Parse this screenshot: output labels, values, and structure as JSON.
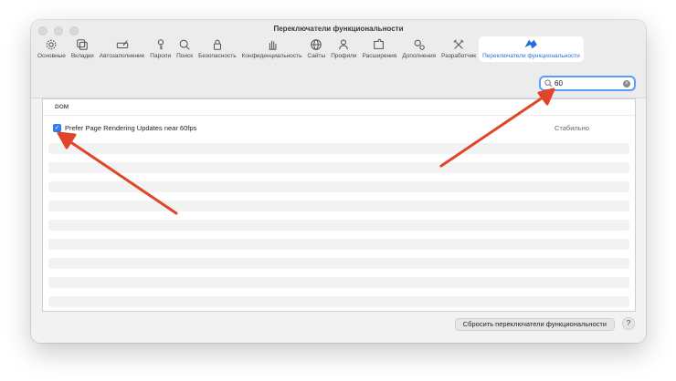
{
  "window": {
    "title": "Переключатели функциональности"
  },
  "toolbar": {
    "items": [
      {
        "label": "Основные",
        "icon": "gear-icon"
      },
      {
        "label": "Вкладки",
        "icon": "tabs-icon"
      },
      {
        "label": "Автозаполнение",
        "icon": "autofill-icon"
      },
      {
        "label": "Пароли",
        "icon": "key-icon"
      },
      {
        "label": "Поиск",
        "icon": "search-icon"
      },
      {
        "label": "Безопасность",
        "icon": "lock-icon"
      },
      {
        "label": "Конфиденциальность",
        "icon": "hand-icon"
      },
      {
        "label": "Сайты",
        "icon": "globe-icon"
      },
      {
        "label": "Профили",
        "icon": "person-icon"
      },
      {
        "label": "Расширения",
        "icon": "puzzle-icon"
      },
      {
        "label": "Дополнения",
        "icon": "gears-icon"
      },
      {
        "label": "Разработчик",
        "icon": "tools-icon"
      },
      {
        "label": "Переключатели функциональности",
        "icon": "flags-icon"
      }
    ],
    "active_index": 12
  },
  "search": {
    "value": "60",
    "placeholder": ""
  },
  "panel": {
    "section": "DOM",
    "rows": [
      {
        "label": "Prefer Page Rendering Updates near 60fps",
        "status": "Стабильно",
        "checked": true
      }
    ]
  },
  "footer": {
    "reset_label": "Сбросить переключатели функциональности",
    "help_label": "?"
  },
  "colors": {
    "accent": "#1f6fde",
    "arrow": "#e0452b",
    "checkbox": "#2f7cf6"
  }
}
